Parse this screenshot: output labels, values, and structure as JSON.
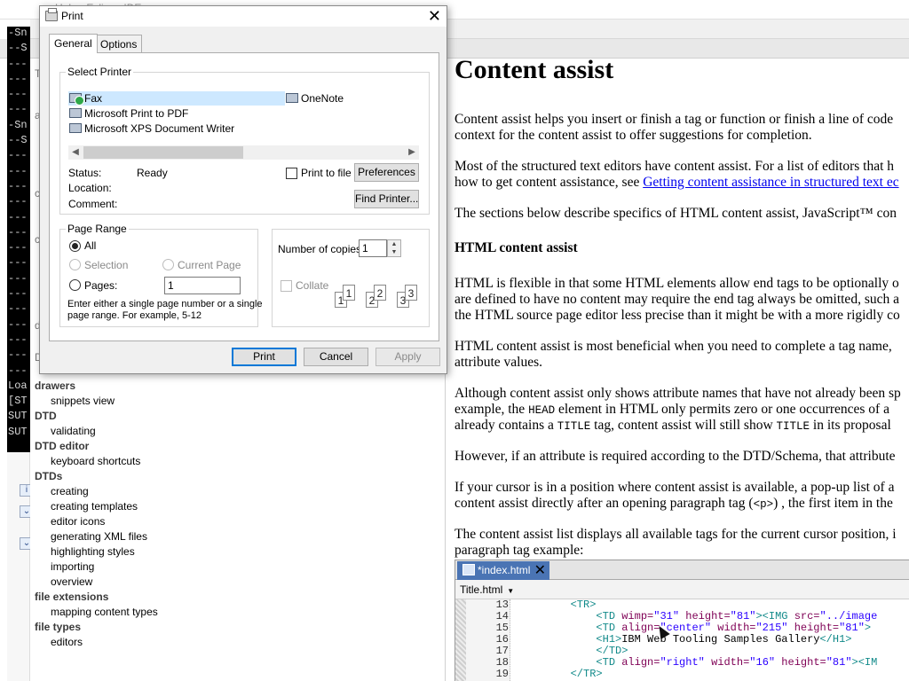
{
  "help_window": {
    "title": "Help - Eclipse IDE",
    "console_lines": [
      "-Sn",
      "--S",
      "---",
      "---",
      "---",
      "---",
      "-Sn",
      "--S",
      "---",
      "---",
      "---",
      "---",
      "---",
      "---",
      "---",
      "---",
      "---",
      "---",
      "---",
      "---",
      "---",
      "---",
      "---",
      "Loa",
      "[ST",
      "SUT",
      "SUT"
    ],
    "index_fragments": [
      "T",
      "a",
      "c",
      "c",
      "d",
      "D"
    ],
    "index": [
      {
        "type": "head",
        "label": "drawers"
      },
      {
        "type": "sub",
        "label": "snippets view"
      },
      {
        "type": "head",
        "label": "DTD"
      },
      {
        "type": "sub",
        "label": "validating"
      },
      {
        "type": "head",
        "label": "DTD editor"
      },
      {
        "type": "sub",
        "label": "keyboard shortcuts"
      },
      {
        "type": "head",
        "label": "DTDs"
      },
      {
        "type": "sub",
        "label": "creating"
      },
      {
        "type": "sub",
        "label": "creating templates"
      },
      {
        "type": "sub",
        "label": "editor icons"
      },
      {
        "type": "sub",
        "label": "generating XML files"
      },
      {
        "type": "sub",
        "label": "highlighting styles"
      },
      {
        "type": "sub",
        "label": "importing"
      },
      {
        "type": "sub",
        "label": "overview"
      },
      {
        "type": "head",
        "label": "file extensions"
      },
      {
        "type": "sub",
        "label": "mapping content types"
      },
      {
        "type": "head",
        "label": "file types"
      },
      {
        "type": "sub",
        "label": "editors"
      }
    ]
  },
  "content": {
    "heading": "Content assist",
    "p1_l1": "Content assist helps you insert or finish a tag or function or finish a line of code",
    "p1_l2": "context for the content assist to offer suggestions for completion.",
    "p2_l1": "Most of the structured text editors have content assist. For a list of editors that h",
    "p2_l2_pre": "how to get content assistance, see ",
    "p2_l2_link": "Getting content assistance in structured text ec",
    "p3_l1": "The sections below describe specifics of HTML content assist, JavaScript™ con",
    "h_html": "HTML content assist",
    "p4_l1": "HTML is flexible in that some HTML elements allow end tags to be optionally o",
    "p4_l2": "are defined to have no content may require the end tag always be omitted, such a",
    "p4_l3": "the HTML source page editor less precise than it might be with a more rigidly co",
    "p5_l1": "HTML content assist is most beneficial when you need to complete a tag name,",
    "p5_l2": "attribute values.",
    "p6_l1": "Although content assist only shows attribute names that have not already been sp",
    "p6_l2_pre": "example, the ",
    "p6_l2_code": "HEAD",
    "p6_l2_post": " element in HTML only permits zero or one occurrences of a",
    "p6_l3_pre": "already contains a ",
    "p6_l3_code": "TITLE",
    "p6_l3_mid": " tag, content assist will still show ",
    "p6_l3_code2": "TITLE",
    "p6_l3_post": " in its proposal",
    "p7_l1": "However, if an attribute is required according to the DTD/Schema, that attribute",
    "p8_l1": "If your cursor is in a position where content assist is available, a pop-up list of a",
    "p8_l2_pre": "content assist directly after an opening paragraph tag (",
    "p8_l2_code": "<p>",
    "p8_l2_post": ") , the first item in the",
    "p9_l1": "The content assist list displays all available tags for the current cursor position, i",
    "p9_l2": "paragraph tag example:"
  },
  "editor": {
    "tab_label": "*index.html",
    "breadcrumb": "Title.html",
    "lines": [
      {
        "num": "13",
        "indent": "        ",
        "parts": [
          {
            "c": "tag",
            "t": "<TR>"
          }
        ]
      },
      {
        "num": "14",
        "indent": "            ",
        "parts": [
          {
            "c": "tag",
            "t": "<TD "
          },
          {
            "c": "attr",
            "t": "wimp="
          },
          {
            "c": "val",
            "t": "\"31\""
          },
          {
            "c": "attr",
            "t": " height="
          },
          {
            "c": "val",
            "t": "\"81\""
          },
          {
            "c": "tag",
            "t": "><IMG "
          },
          {
            "c": "attr",
            "t": "src="
          },
          {
            "c": "val",
            "t": "\"../image"
          }
        ]
      },
      {
        "num": "15",
        "indent": "            ",
        "parts": [
          {
            "c": "tag",
            "t": "<TD "
          },
          {
            "c": "attr",
            "t": "align="
          },
          {
            "c": "val",
            "t": "\"center\""
          },
          {
            "c": "attr",
            "t": " width="
          },
          {
            "c": "val",
            "t": "\"215\""
          },
          {
            "c": "attr",
            "t": " height="
          },
          {
            "c": "val",
            "t": "\"81\""
          },
          {
            "c": "tag",
            "t": ">"
          }
        ]
      },
      {
        "num": "16",
        "indent": "            ",
        "parts": [
          {
            "c": "tag",
            "t": "<H1>"
          },
          {
            "c": "txt",
            "t": "IBM Web Tooling Samples Gallery"
          },
          {
            "c": "tag",
            "t": "</H1>"
          }
        ]
      },
      {
        "num": "17",
        "indent": "            ",
        "parts": [
          {
            "c": "tag",
            "t": "</TD>"
          }
        ]
      },
      {
        "num": "18",
        "indent": "            ",
        "parts": [
          {
            "c": "tag",
            "t": "<TD "
          },
          {
            "c": "attr",
            "t": "align="
          },
          {
            "c": "val",
            "t": "\"right\""
          },
          {
            "c": "attr",
            "t": " width="
          },
          {
            "c": "val",
            "t": "\"16\""
          },
          {
            "c": "attr",
            "t": " height="
          },
          {
            "c": "val",
            "t": "\"81\""
          },
          {
            "c": "tag",
            "t": "><IM"
          }
        ]
      },
      {
        "num": "19",
        "indent": "        ",
        "parts": [
          {
            "c": "tag",
            "t": "</TR>"
          }
        ]
      }
    ]
  },
  "print_dialog": {
    "title": "Print",
    "tabs": [
      "General",
      "Options"
    ],
    "select_printer_label": "Select Printer",
    "printers": [
      "Fax",
      "OneNote",
      "Microsoft Print to PDF",
      "Microsoft XPS Document Writer"
    ],
    "selected_printer": "Fax",
    "status_label": "Status:",
    "status_value": "Ready",
    "location_label": "Location:",
    "comment_label": "Comment:",
    "print_to_file_label": "Print to file",
    "preferences_label": "Preferences",
    "find_printer_label": "Find Printer...",
    "page_range_label": "Page Range",
    "all_label": "All",
    "selection_label": "Selection",
    "current_page_label": "Current Page",
    "pages_label": "Pages:",
    "pages_value": "1",
    "page_range_hint_l1": "Enter either a single page number or a single",
    "page_range_hint_l2": "page range.  For example, 5-12",
    "copies_label": "Number of copies:",
    "copies_value": "1",
    "collate_label": "Collate",
    "collate_pages": [
      "1",
      "1",
      "2",
      "2",
      "3",
      "3"
    ],
    "print_button": "Print",
    "cancel_button": "Cancel",
    "apply_button": "Apply"
  },
  "colors": {
    "accent": "#0078d7",
    "selection": "#cde8ff",
    "editor_tab": "#4a74b4",
    "link": "#0000ee"
  }
}
